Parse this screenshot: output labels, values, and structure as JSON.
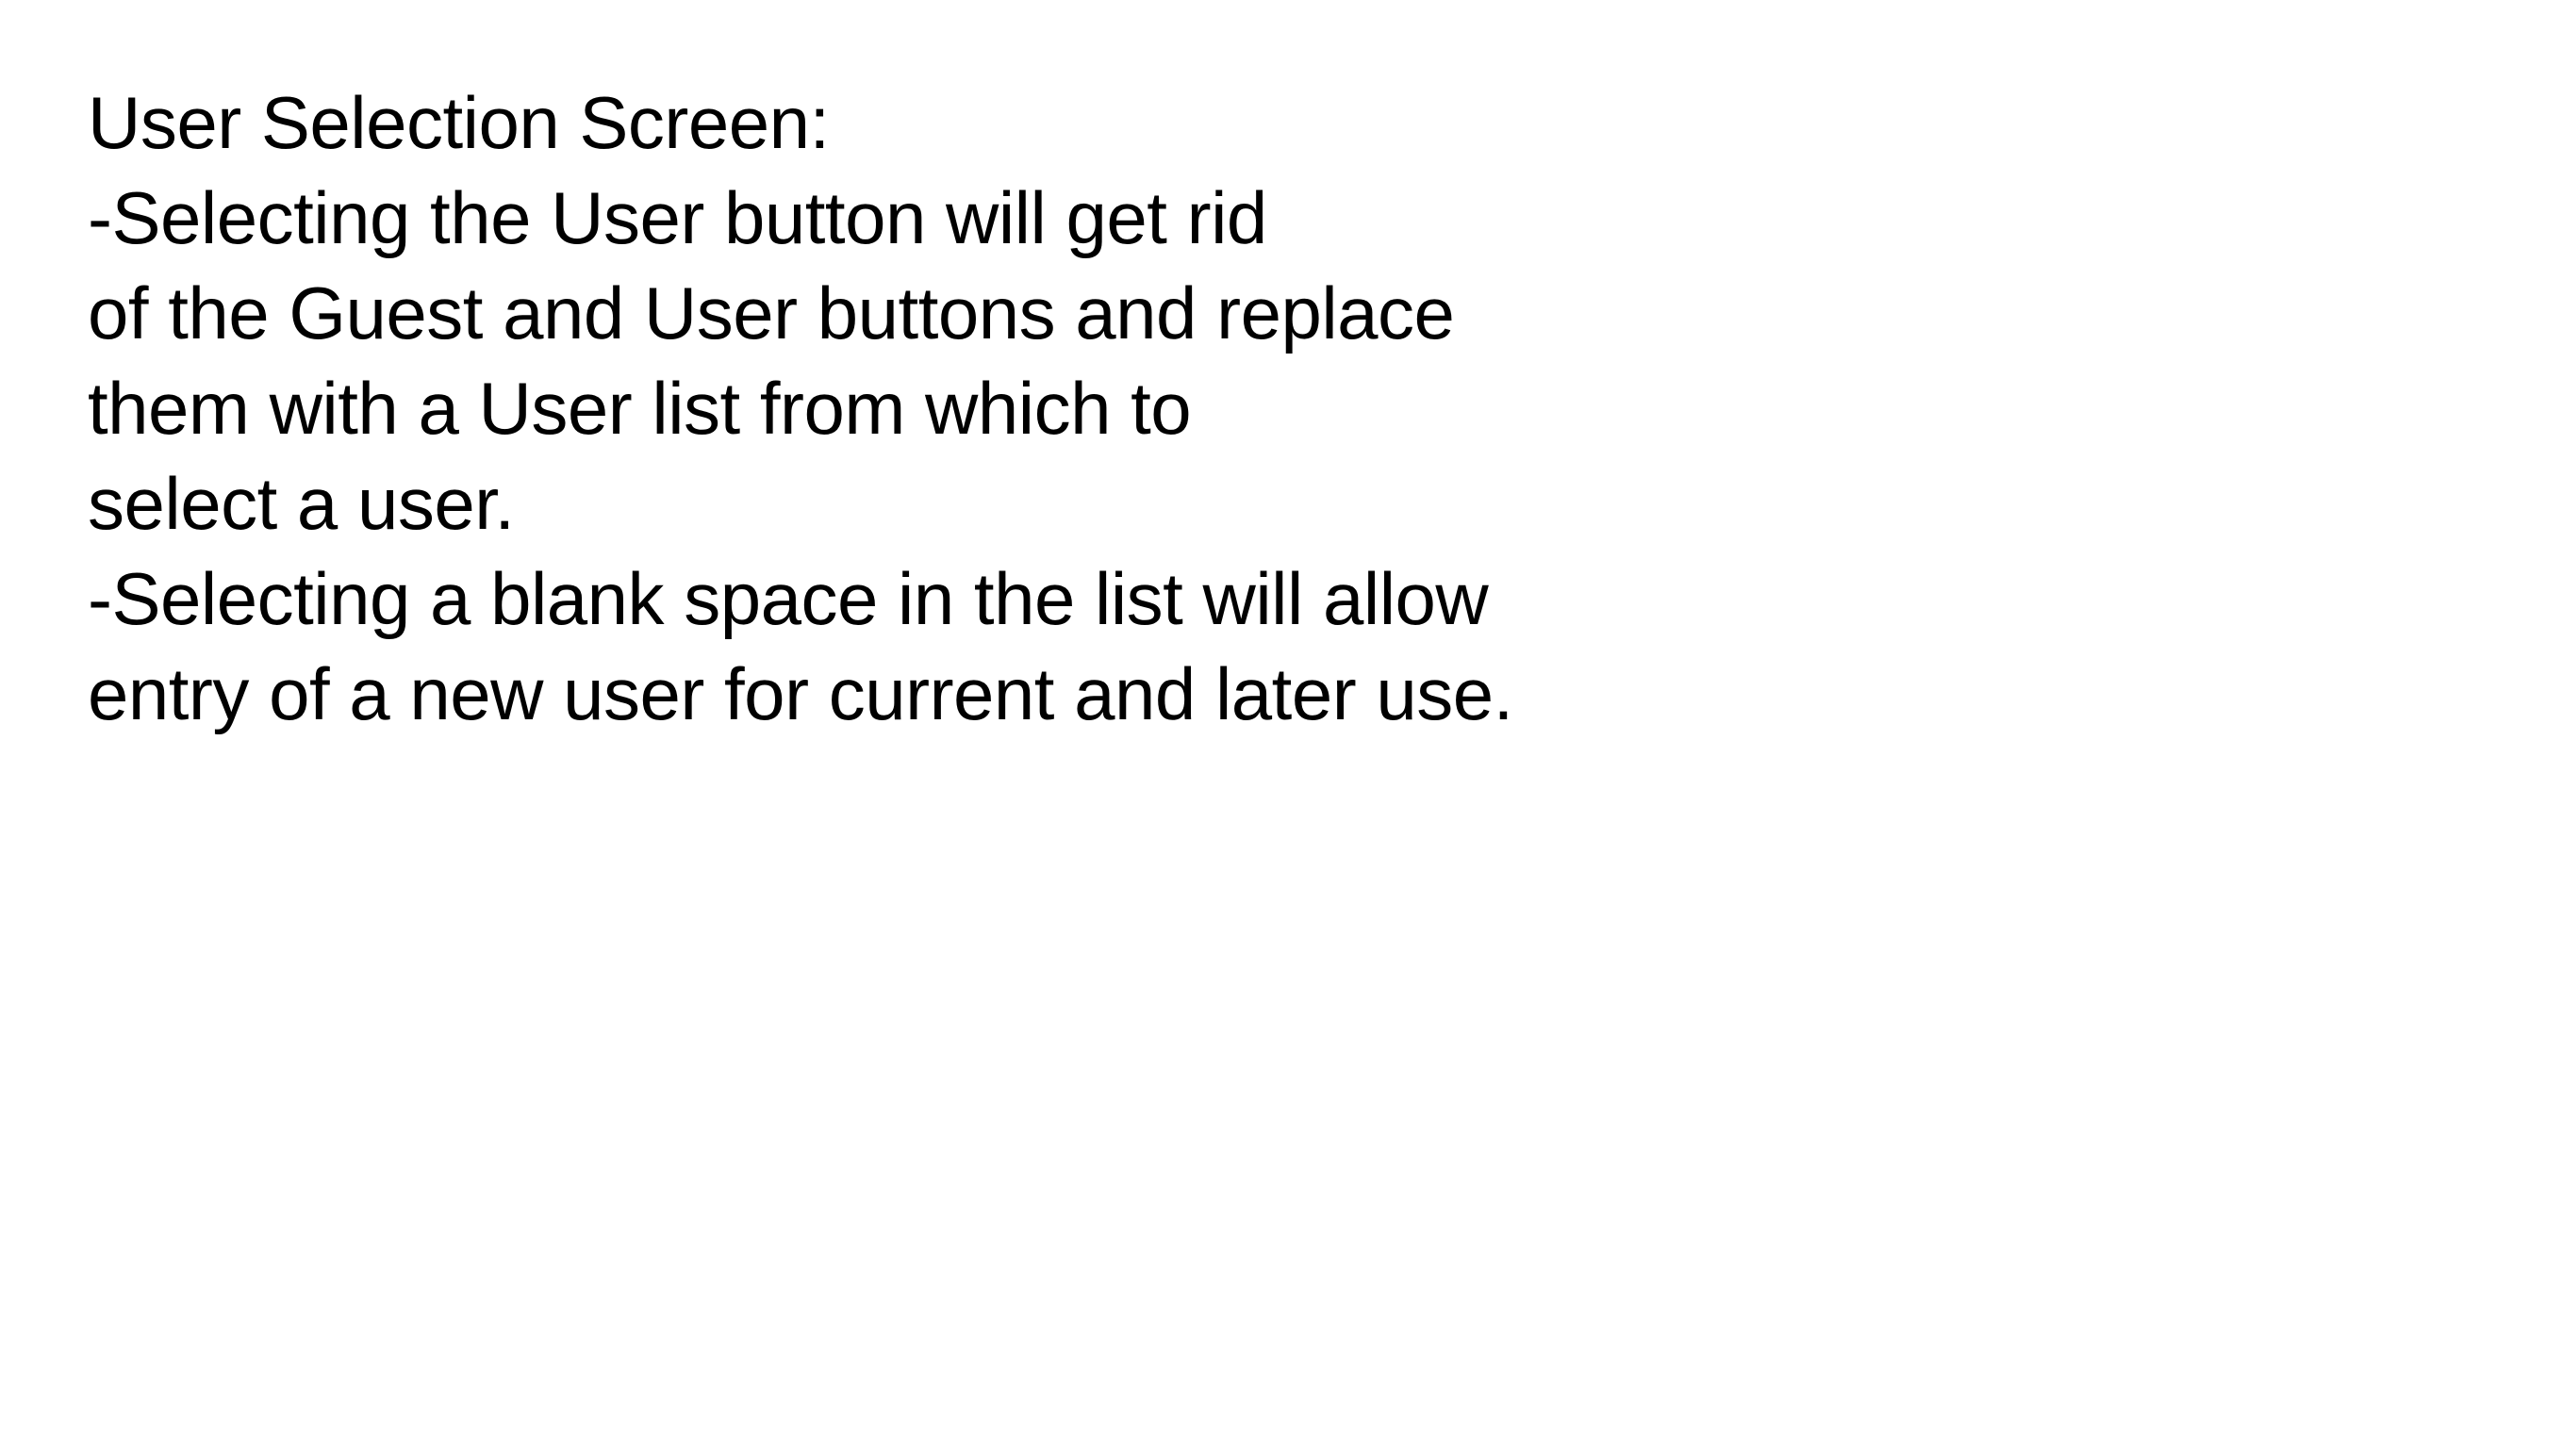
{
  "note": {
    "lines": [
      "User Selection Screen:",
      "-Selecting the User button will get rid",
      "of the Guest and User buttons and replace",
      "them with a User list from which to",
      "select a user.",
      "-Selecting a blank space in the list will allow",
      "entry of a new user for current and later use."
    ]
  },
  "colors": {
    "background": "#ffffff",
    "text": "#000000"
  }
}
